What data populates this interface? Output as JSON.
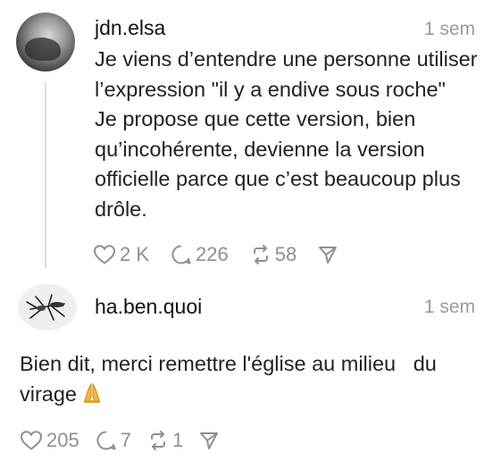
{
  "posts": [
    {
      "username": "jdn.elsa",
      "timestamp": "1 sem",
      "lines": [
        "Je viens d’entendre une personne utiliser",
        "l’expression \"il y a endive sous roche\"",
        "Je propose que cette version, bien",
        "qu’incohérente, devienne la version",
        "officielle parce que c’est beaucoup plus",
        "drôle."
      ],
      "likes": "2 K",
      "replies": "226",
      "reposts": "58"
    },
    {
      "username": "ha.ben.quoi",
      "timestamp": "1 sem",
      "lines": [
        "Bien dit, merci remettre l'église au milieu   du",
        "virage"
      ],
      "likes": "205",
      "replies": "7",
      "reposts": "1"
    }
  ],
  "icons": {
    "like": "heart-icon",
    "reply": "comment-icon",
    "repost": "repost-icon",
    "share": "send-icon",
    "emoji": "praying-hands-emoji"
  },
  "colors": {
    "text": "#222222",
    "muted": "#8f8f8f",
    "thread_line": "#dcdcdc"
  }
}
